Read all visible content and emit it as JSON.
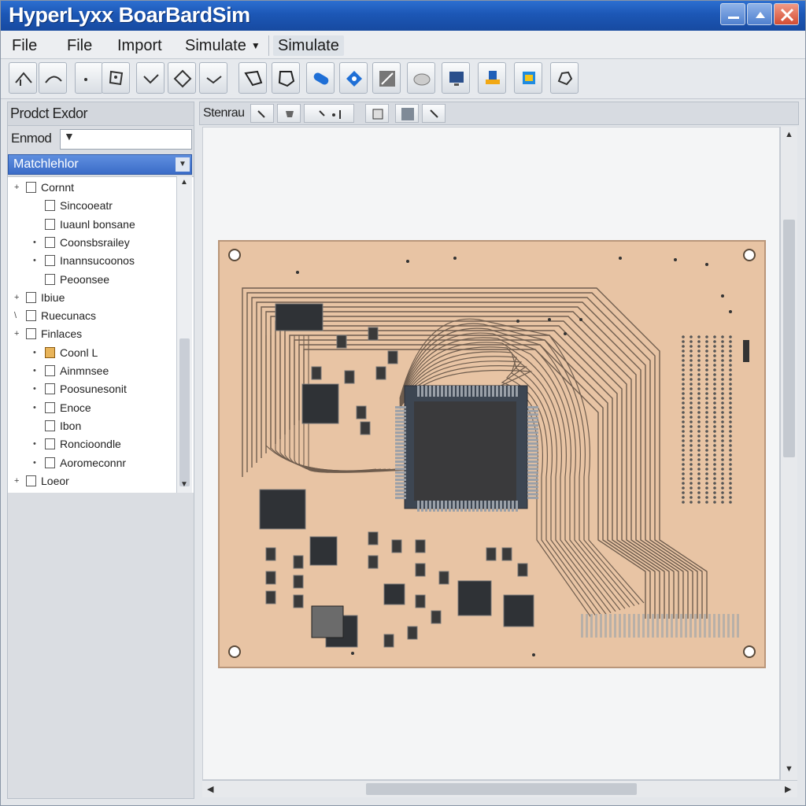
{
  "window": {
    "title": "HyperLyxx BoarBardSim",
    "controls": [
      "minimize",
      "maximize",
      "close"
    ]
  },
  "menu": {
    "items": [
      {
        "label": "File"
      },
      {
        "label": "File"
      },
      {
        "label": "Import"
      },
      {
        "label": "Simulate",
        "has_dropdown": true
      },
      {
        "label": "Simulate"
      }
    ]
  },
  "toolbar": {
    "buttons": [
      "home-icon",
      "curve-icon",
      "component-icon",
      "arrow-icon",
      "diamond-icon",
      "check-icon",
      "polygon-icon",
      "shape-icon",
      "route-icon",
      "blue-diamond-icon",
      "measure-icon",
      "cloud-icon",
      "monitor-icon",
      "board-icon",
      "layers-icon",
      "settings-icon"
    ]
  },
  "left_panel": {
    "title": "Prodct Exdor",
    "filter_label": "Enmod",
    "filter_value": "",
    "selected_item": "Matchlehlor",
    "tree": [
      {
        "label": "Cornnt",
        "level": 0,
        "expander": "+"
      },
      {
        "label": "Sincooeatr",
        "level": 1,
        "expander": ""
      },
      {
        "label": "Iuaunl bonsane",
        "level": 1,
        "expander": ""
      },
      {
        "label": "Coonsbsrailey",
        "level": 1,
        "expander": "•"
      },
      {
        "label": "Inannsucoonos",
        "level": 1,
        "expander": "•"
      },
      {
        "label": "Peoonsee",
        "level": 1,
        "expander": ""
      },
      {
        "label": "Ibiue",
        "level": 0,
        "expander": "+"
      },
      {
        "label": "Ruecunacs",
        "level": 0,
        "expander": "\\"
      },
      {
        "label": "Finlaces",
        "level": 0,
        "expander": "+"
      },
      {
        "label": "Coonl L",
        "level": 1,
        "expander": "•",
        "folder": true
      },
      {
        "label": "Ainmnsee",
        "level": 1,
        "expander": "•"
      },
      {
        "label": "Poosunesonit",
        "level": 1,
        "expander": "•"
      },
      {
        "label": "Enoce",
        "level": 1,
        "expander": "•"
      },
      {
        "label": "Ibon",
        "level": 1,
        "expander": ""
      },
      {
        "label": "Roncioondle",
        "level": 1,
        "expander": "•"
      },
      {
        "label": "Aoromeconnr",
        "level": 1,
        "expander": "•"
      },
      {
        "label": "Loeor",
        "level": 0,
        "expander": "+"
      }
    ]
  },
  "canvas": {
    "title": "Stenrau",
    "tools": [
      "pointer-icon",
      "pan-icon",
      "probe-icon",
      "grid-icon",
      "fill-icon",
      "pen-icon"
    ]
  },
  "colors": {
    "title_bar": "#1c57b6",
    "board": "#e8c4a4",
    "selection": "#3b6cc8"
  }
}
